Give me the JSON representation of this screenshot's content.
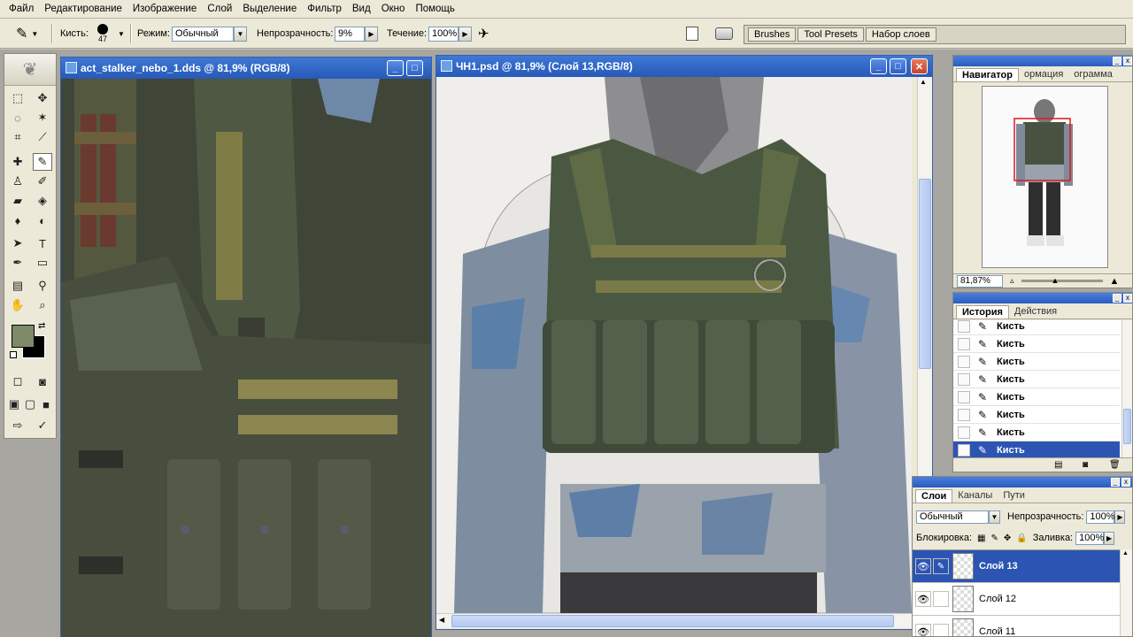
{
  "menu": [
    "Файл",
    "Редактирование",
    "Изображение",
    "Слой",
    "Выделение",
    "Фильтр",
    "Вид",
    "Окно",
    "Помощь"
  ],
  "options": {
    "brush_label": "Кисть:",
    "brush_size": "47",
    "mode_label": "Режим:",
    "mode_value": "Обычный",
    "opacity_label": "Непрозрачность:",
    "opacity_value": "9%",
    "flow_label": "Течение:",
    "flow_value": "100%"
  },
  "palette_well": [
    "Brushes",
    "Tool Presets",
    "Набор слоев"
  ],
  "doc1": {
    "title": "act_stalker_nebo_1.dds @ 81,9% (RGB/8)"
  },
  "doc2": {
    "title": "ЧН1.psd @ 81,9% (Слой 13,RGB/8)"
  },
  "navigator": {
    "tabs": [
      "Навигатор",
      "ормация",
      "ограмма"
    ],
    "zoom": "81,87%"
  },
  "history": {
    "tabs": [
      "История",
      "Действия"
    ],
    "items": [
      "Кисть",
      "Кисть",
      "Кисть",
      "Кисть",
      "Кисть",
      "Кисть",
      "Кисть",
      "Кисть"
    ]
  },
  "layers": {
    "tabs": [
      "Слои",
      "Каналы",
      "Пути"
    ],
    "blend_mode": "Обычный",
    "opacity_label": "Непрозрачность:",
    "opacity_value": "100%",
    "lock_label": "Блокировка:",
    "fill_label": "Заливка:",
    "fill_value": "100%",
    "items": [
      "Слой 13",
      "Слой 12",
      "Слой 11"
    ]
  },
  "colors": {
    "foreground": "#7e8a68",
    "background": "#000000",
    "titlebar": "#2a5cc0",
    "selection": "#2c55b3"
  }
}
